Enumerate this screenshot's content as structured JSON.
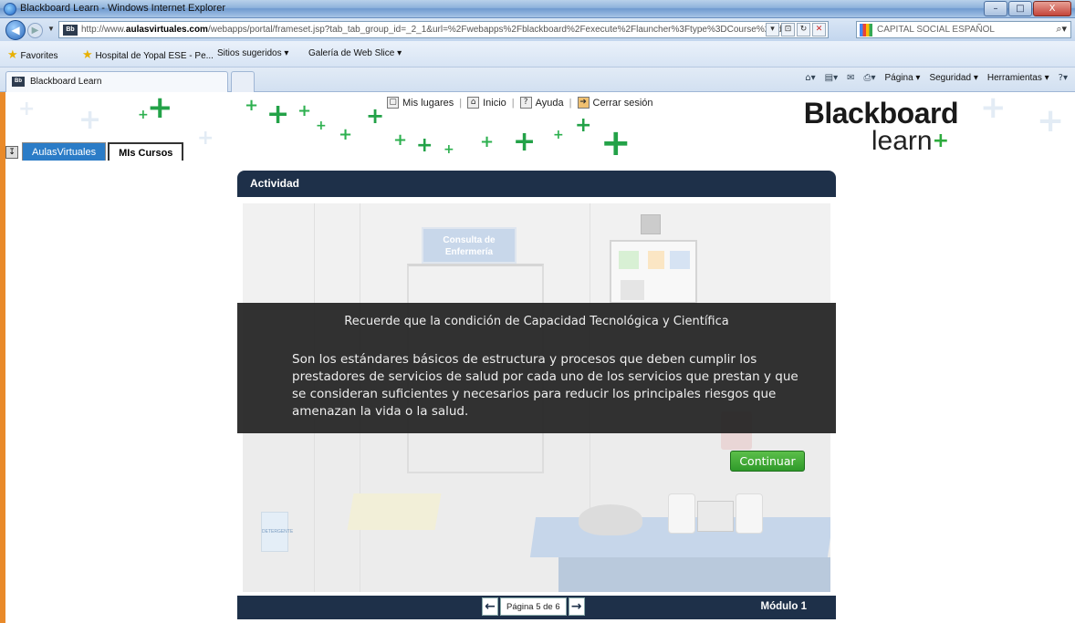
{
  "window": {
    "title": "Blackboard Learn - Windows Internet Explorer",
    "minimize": "–",
    "maximize": "□",
    "close": "X"
  },
  "address": {
    "back_glyph": "◀",
    "forward_glyph": "▶",
    "url_prefix": "http://www.",
    "url_host": "aulasvirtuales.com",
    "url_path": "/webapps/portal/frameset.jsp?tab_tab_group_id=_2_1&url=%2Fwebapps%2Fblackboard%2Fexecute%2Flauncher%3Ftype%3DCourse%26id%3D_1",
    "search_placeholder": "CAPITAL SOCIAL ESPAÑOL"
  },
  "favorites": {
    "favorites_label": "Favorites",
    "items": [
      "Hospital de Yopal ESE - Pe...",
      "Sitios sugeridos ▾",
      "Galería de Web Slice ▾"
    ]
  },
  "tabs": {
    "active_label": "Blackboard Learn"
  },
  "command_bar": {
    "page": "Página ▾",
    "security": "Seguridad ▾",
    "tools": "Herramientas ▾"
  },
  "bb": {
    "logo_line1": "Blackboard",
    "logo_line2": "learn",
    "top_links": [
      "Mis lugares",
      "Inicio",
      "Ayuda",
      "Cerrar sesión"
    ],
    "nav_tabs": [
      "AulasVirtuales",
      "MIs Cursos"
    ]
  },
  "activity": {
    "header": "Actividad",
    "sign_line1": "Consulta de",
    "sign_line2": "Enfermería",
    "overlay_title": "Recuerde que la condición de Capacidad Tecnológica y Científica",
    "overlay_body": "Son los estándares básicos de estructura y procesos que deben cumplir los prestadores de servicios de salud por cada uno de los servicios que prestan y que se consideran suficientes y necesarios para reducir los principales riesgos que amenazan la vida o la salud.",
    "continue_label": "Continuar",
    "pager_label": "Página 5 de 6",
    "module_label": "Módulo 1",
    "detergent_label": "DETERGENTE"
  },
  "colors": {
    "header_navy": "#1e3049",
    "continue_green": "#3aa534",
    "overlay_dark": "#222222",
    "frame_orange": "#e98a2a",
    "tab_blue": "#2b7cc7"
  }
}
